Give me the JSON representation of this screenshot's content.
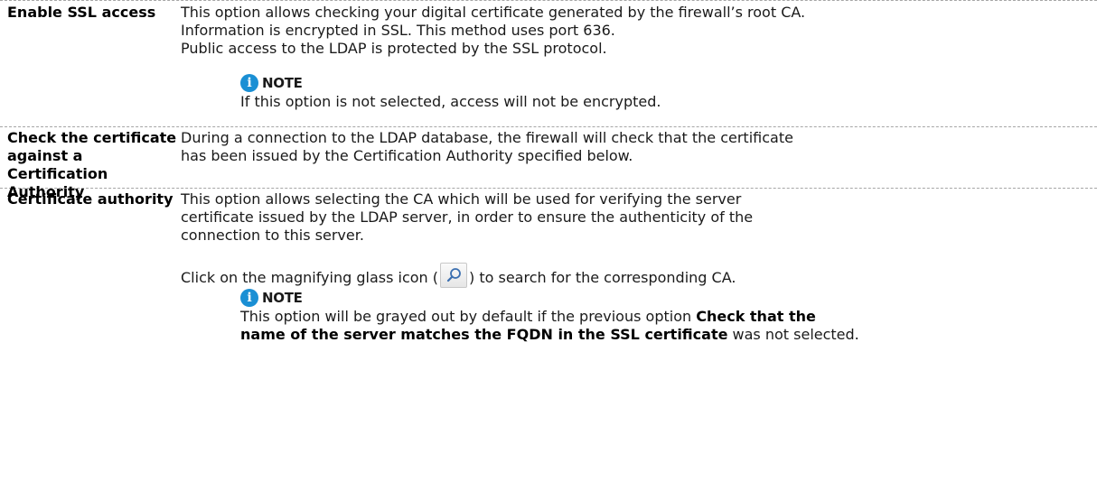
{
  "rows": [
    {
      "term": "Enable SSL access",
      "lines": [
        "This option allows checking your digital certificate generated by the firewall’s root CA.",
        "Information is encrypted in SSL. This method uses port 636.",
        "Public access to the LDAP is protected by the SSL protocol."
      ],
      "note": {
        "title": "NOTE",
        "text": "If this option is not selected, access will not be encrypted."
      }
    },
    {
      "term_lines": [
        "Check the certificate",
        "against a Certification",
        "Authority"
      ],
      "lines": [
        "During a connection to the LDAP database, the firewall will check that the certificate",
        "has been issued by the Certification Authority specified below."
      ]
    },
    {
      "term": "Certificate authority",
      "lines": [
        "This option allows selecting the CA which will be used for verifying the server",
        "certificate issued by the LDAP server, in order to ensure the authenticity of the",
        "connection to this server."
      ],
      "click_before": "Click on the magnifying glass icon (",
      "click_after": ") to search for the corresponding CA.",
      "note": {
        "title": "NOTE",
        "text_before": "This option will be grayed out by default if the previous option ",
        "text_bold_1": "Check that the",
        "text_bold_2": "name of the server matches the FQDN in the SSL certificate",
        "text_after": " was not selected."
      }
    }
  ],
  "icons": {
    "info": "info-icon",
    "magnifier": "magnifying-glass-icon"
  },
  "colors": {
    "info_icon": "#1a8fd4",
    "divider": "#a6a6a6"
  }
}
